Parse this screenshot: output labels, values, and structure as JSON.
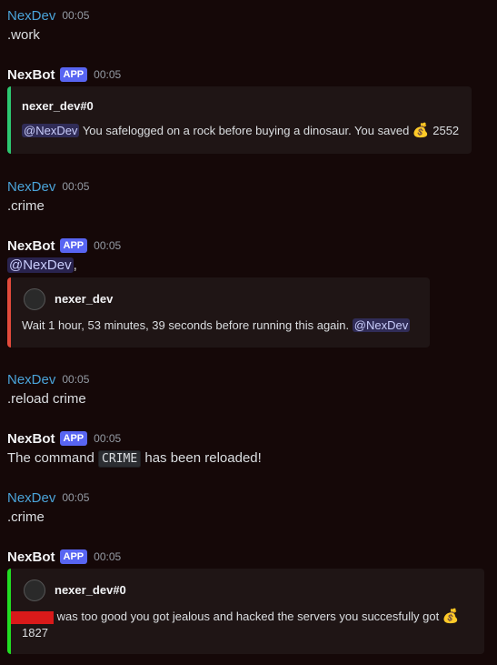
{
  "messages": [
    {
      "author": "NexDev",
      "time": "00:05",
      "text": ".work"
    },
    {
      "author": "NexBot",
      "badge": "APP",
      "time": "00:05",
      "embed": {
        "author": "nexer_dev#0",
        "mention": "@NexDev",
        "text": "You safelogged on a rock before buying a dinosaur. You saved",
        "icon": "money-bag-icon",
        "amount": "2552",
        "accent": "#2dc770"
      }
    },
    {
      "author": "NexDev",
      "time": "00:05",
      "text": ".crime"
    },
    {
      "author": "NexBot",
      "badge": "APP",
      "time": "00:05",
      "mention": "@NexDev",
      "after_mention": ",",
      "embed": {
        "author": "nexer_dev",
        "text": "Wait 1 hour, 53 minutes, 39 seconds before running this again.",
        "mention": "@NexDev",
        "accent": "#e24a3b"
      }
    },
    {
      "author": "NexDev",
      "time": "00:05",
      "text": ".reload crime"
    },
    {
      "author": "NexBot",
      "badge": "APP",
      "time": "00:05",
      "text_before": "The command",
      "code": "CRIME",
      "text_after": "has been reloaded!"
    },
    {
      "author": "NexDev",
      "time": "00:05",
      "text": ".crime"
    },
    {
      "author": "NexBot",
      "badge": "APP",
      "time": "00:05",
      "embed": {
        "author": "nexer_dev#0",
        "text": "was too good you got jealous and hacked the servers you succesfully got",
        "icon": "money-bag-icon",
        "amount": "1827",
        "accent": "#22dd22"
      }
    }
  ]
}
